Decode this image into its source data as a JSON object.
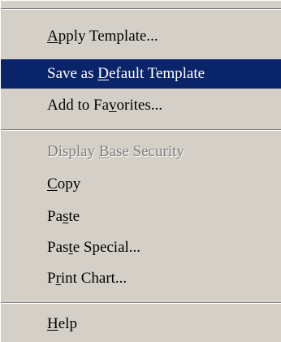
{
  "menu": {
    "colors": {
      "menu_bg": "#d4d0c8",
      "selected_bg": "#0a246a",
      "selected_text": "#ffffff",
      "disabled_text": "#808080"
    },
    "items": [
      {
        "pre": "",
        "key": "A",
        "post": "pply Template...",
        "state": "normal"
      },
      {
        "pre": "Save as ",
        "key": "D",
        "post": "efault Template",
        "state": "selected"
      },
      {
        "pre": "Add to Fa",
        "key": "v",
        "post": "orites...",
        "state": "normal"
      },
      {
        "pre": "Display ",
        "key": "B",
        "post": "ase Security",
        "state": "disabled"
      },
      {
        "pre": "",
        "key": "C",
        "post": "opy",
        "state": "normal"
      },
      {
        "pre": "Pa",
        "key": "s",
        "post": "te",
        "state": "normal"
      },
      {
        "pre": "Pas",
        "key": "t",
        "post": "e Special...",
        "state": "normal"
      },
      {
        "pre": "P",
        "key": "r",
        "post": "int Chart...",
        "state": "normal"
      },
      {
        "pre": "",
        "key": "H",
        "post": "elp",
        "state": "normal"
      }
    ]
  }
}
